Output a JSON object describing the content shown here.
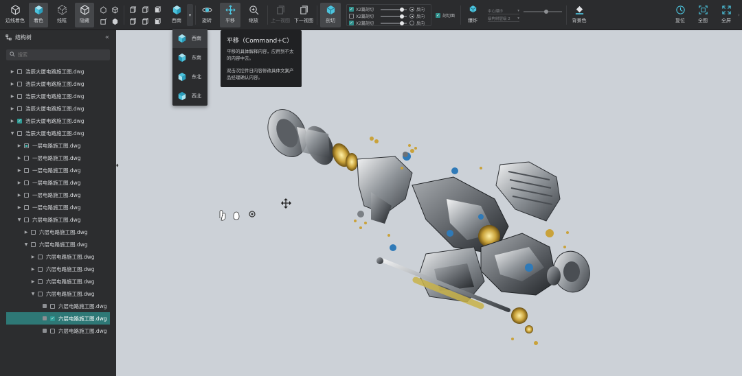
{
  "toolbar": {
    "edge_shading": "边线着色",
    "shading": "着色",
    "wireframe": "线框",
    "hide": "隐藏",
    "view_sw": "西南",
    "rotate": "旋转",
    "pan": "平移",
    "zoom": "缩放",
    "prev_view": "上一视图",
    "next_view": "下一视图",
    "section": "剖切",
    "section_rows": [
      {
        "label": "X2篇剖切",
        "checked": true,
        "radio": "反向",
        "radio_on": true,
        "slider_fraction": 0.78
      },
      {
        "label": "X2篇剖切",
        "checked": false,
        "radio": "反向",
        "radio_on": true,
        "slider_fraction": 0.78
      },
      {
        "label": "X2篇剖切",
        "checked": true,
        "radio": "反向",
        "radio_on": false,
        "slider_fraction": 0.78
      }
    ],
    "section_face": "剖切面",
    "explode": "爆炸",
    "explode_center": "中心爆炸",
    "explode_level": "级构树层级 2",
    "explode_slider_fraction": 0.7,
    "background": "背景色",
    "reset": "复位",
    "fit_all": "全图",
    "fullscreen": "全屏"
  },
  "sidebar": {
    "title": "结构树",
    "search_placeholder": "搜索",
    "rows": [
      {
        "label": "浩辰大厦电路施工图.dwg",
        "level": 0,
        "arrow": "▶",
        "check": "off"
      },
      {
        "label": "浩辰大厦电路施工图.dwg",
        "level": 0,
        "arrow": "▶",
        "check": "off"
      },
      {
        "label": "浩辰大厦电路施工图.dwg",
        "level": 0,
        "arrow": "▶",
        "check": "off"
      },
      {
        "label": "浩辰大厦电路施工图.dwg",
        "level": 0,
        "arrow": "▶",
        "check": "off"
      },
      {
        "label": "浩辰大厦电路施工图.dwg",
        "level": 0,
        "arrow": "▶",
        "check": "on"
      },
      {
        "label": "浩辰大厦电路施工图.dwg",
        "level": 0,
        "arrow": "▼",
        "check": "off"
      },
      {
        "label": "一层电路施工图.dwg",
        "level": 1,
        "arrow": "▶",
        "check": "partial"
      },
      {
        "label": "一层电路施工图.dwg",
        "level": 1,
        "arrow": "▶",
        "check": "off"
      },
      {
        "label": "一层电路施工图.dwg",
        "level": 1,
        "arrow": "▶",
        "check": "off"
      },
      {
        "label": "一层电路施工图.dwg",
        "level": 1,
        "arrow": "▶",
        "check": "off"
      },
      {
        "label": "一层电路施工图.dwg",
        "level": 1,
        "arrow": "▶",
        "check": "off"
      },
      {
        "label": "一层电路施工图.dwg",
        "level": 1,
        "arrow": "▶",
        "check": "off"
      },
      {
        "label": "六层电路施工图.dwg",
        "level": 1,
        "arrow": "▼",
        "check": "off"
      },
      {
        "label": "六层电路施工图.dwg",
        "level": 2,
        "arrow": "▶",
        "check": "off"
      },
      {
        "label": "六层电路施工图.dwg",
        "level": 2,
        "arrow": "▼",
        "check": "off"
      },
      {
        "label": "六层电路施工图.dwg",
        "level": 3,
        "arrow": "▶",
        "check": "off"
      },
      {
        "label": "六层电路施工图.dwg",
        "level": 3,
        "arrow": "▶",
        "check": "off"
      },
      {
        "label": "六层电路施工图.dwg",
        "level": 3,
        "arrow": "▶",
        "check": "off"
      },
      {
        "label": "六层电路施工图.dwg",
        "level": 3,
        "arrow": "▼",
        "check": "off"
      },
      {
        "label": "六层电路施工图.dwg",
        "level": 4,
        "arrow": "",
        "check": "off",
        "lock": true
      },
      {
        "label": "六层电路施工图.dwg",
        "level": 4,
        "arrow": "",
        "check": "on",
        "lock": true,
        "selected": true
      },
      {
        "label": "六层电路施工图.dwg",
        "level": 4,
        "arrow": "",
        "check": "off",
        "lock": true
      }
    ]
  },
  "view_menu": {
    "items": [
      "西南",
      "东南",
      "东北",
      "西北"
    ]
  },
  "tooltip": {
    "title": "平移（Command+C）",
    "line1": "平移的具体解释内容，应用到不太的内容中去。",
    "line2": "双击次控件日内容修改具体文案产品经理确认内容。"
  },
  "colors": {
    "accent": "#2f9b95",
    "selected_row": "#2e7876",
    "viewport_bg": "#ccd1d7",
    "toolbar_bg": "#2b2c2e"
  }
}
